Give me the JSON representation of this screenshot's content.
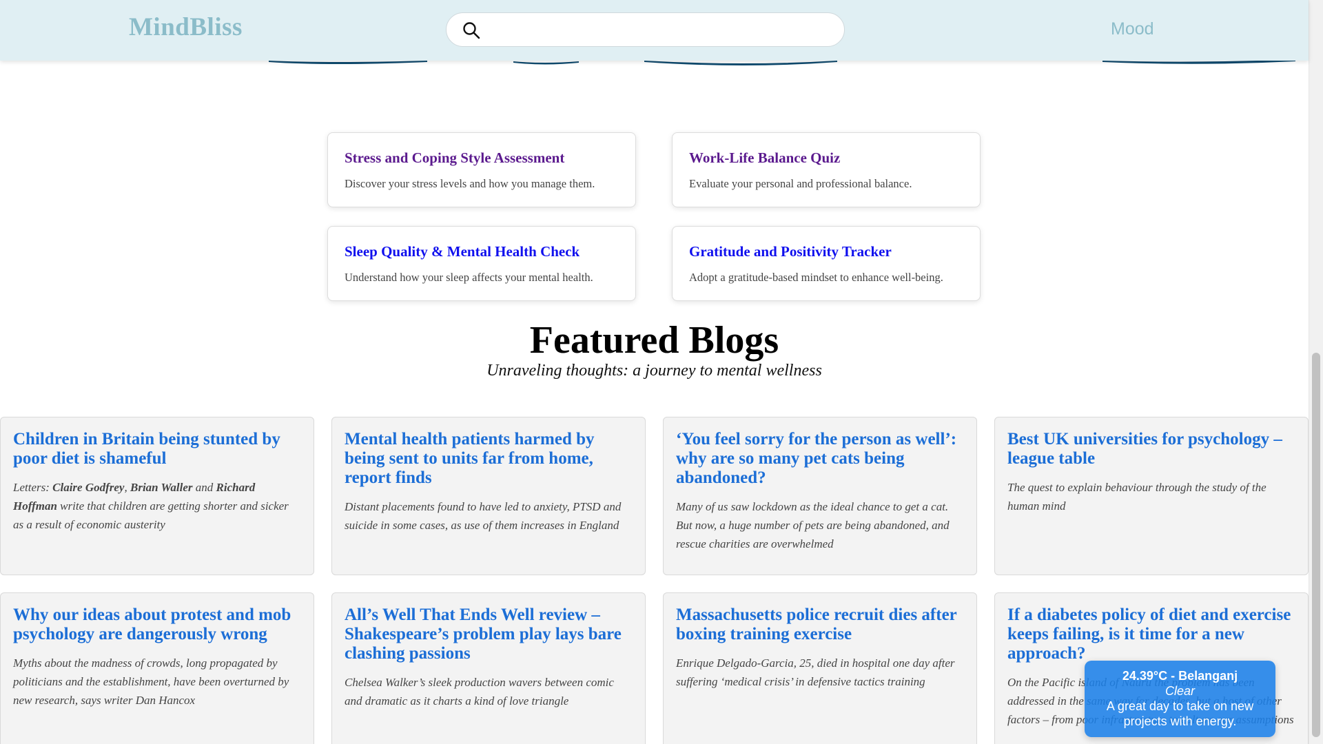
{
  "header": {
    "logo": "MindBliss",
    "search_placeholder": "",
    "nav_mood": "Mood"
  },
  "quizzes": [
    {
      "title": "Stress and Coping Style Assessment",
      "description": "Discover your stress levels and how you manage them.",
      "visited": true
    },
    {
      "title": "Work-Life Balance Quiz",
      "description": "Evaluate your personal and professional balance.",
      "visited": true
    },
    {
      "title": "Sleep Quality & Mental Health Check",
      "description": "Understand how your sleep affects your mental health.",
      "visited": false
    },
    {
      "title": "Gratitude and Positivity Tracker",
      "description": "Adopt a gratitude-based mindset to enhance well-being.",
      "visited": false
    }
  ],
  "featured": {
    "title": "Featured Blogs",
    "subtitle": "Unraveling thoughts: a journey to mental wellness"
  },
  "blogs": [
    {
      "title": "Children in Britain being stunted by poor diet is shameful",
      "desc_html": "Letters: <b>Claire Godfrey</b>, <b>Brian Waller</b> and <b>Richard Hoffman</b> write that children are getting shorter and sicker as a result of economic austerity"
    },
    {
      "title": "Mental health patients harmed by being sent to units far from home, report finds",
      "desc_html": "Distant placements found to have led to anxiety, PTSD and suicide in some cases, as use of them increases in England"
    },
    {
      "title": "‘You feel sorry for the person as well’: why are so many pet cats being abandoned?",
      "desc_html": "Many of us saw lockdown as the ideal chance to get a cat. But now, a huge number of pets are being abandoned, and rescue charities are overwhelmed"
    },
    {
      "title": "Best UK universities for psychology – league table",
      "desc_html": "The quest to explain behaviour through the study of the human mind"
    },
    {
      "title": "Why our ideas about protest and mob psychology are dangerously wrong",
      "desc_html": "Myths about the madness of crowds, long propagated by politicians and the establishment, have been overturned by new research, says writer Dan Hancox"
    },
    {
      "title": "All’s Well That Ends Well review – Shakespeare’s problem play lays bare clashing passions",
      "desc_html": "Chelsea Walker’s sleek production wavers between comic and dramatic as it charts a kind of love triangle"
    },
    {
      "title": "Massachusetts police recruit dies after boxing training exercise",
      "desc_html": "Enrique Delgado-Garcia, 25, died in hospital one day after suffering ‘medical crisis’ in defensive tactics training"
    },
    {
      "title": "If a diabetes policy of diet and exercise keeps failing, is it time for a new approach?",
      "desc_html": "On the Pacific island of Nauru the problem has been addressed in the same way for decades, but a host of other factors – from poor infrastructure to culture our assumptions"
    }
  ],
  "weather": {
    "temp_location": "24.39°C - Belanganj",
    "condition": "Clear",
    "message": "A great day to take on new projects with energy."
  },
  "colors": {
    "header_bg": "#e0eff3",
    "logo": "#8bbcc9",
    "visited_link": "#5b1a8e",
    "unvisited_link": "#1010ee",
    "blog_title": "#1c6ed6",
    "weather_bg": "#1b80e8"
  }
}
